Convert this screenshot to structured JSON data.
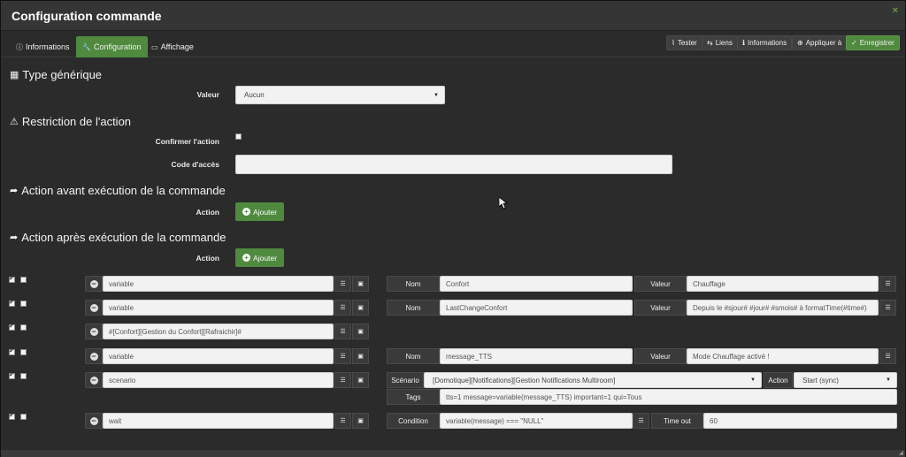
{
  "window": {
    "title": "Configuration commande",
    "close": "×"
  },
  "tabs": [
    {
      "label": "Informations",
      "icon": "ⓘ"
    },
    {
      "label": "Configuration",
      "icon": "🔧"
    },
    {
      "label": "Affichage",
      "icon": "▭"
    }
  ],
  "toolbar": {
    "tester": "Tester",
    "liens": "Liens",
    "informations": "Informations",
    "appliquer": "Appliquer à",
    "enregistrer": "Enregistrer",
    "icons": {
      "tester": "rss-icon",
      "liens": "link-icon",
      "informations": "info-icon",
      "appliquer": "plus-circle-icon",
      "enregistrer": "check-circle-icon"
    }
  },
  "generic_type": {
    "title": "Type générique",
    "valeur_label": "Valeur",
    "valeur_selected": "Aucun"
  },
  "restriction": {
    "title": "Restriction de l'action",
    "confirm_label": "Confirmer l'action",
    "confirm_checked": false,
    "code_label": "Code d'accès",
    "code_value": ""
  },
  "pre_exec": {
    "title": "Action avant exécution de la commande",
    "action_label": "Action",
    "add_label": "Ajouter"
  },
  "post_exec": {
    "title": "Action après exécution de la commande",
    "action_label": "Action",
    "add_label": "Ajouter",
    "rows": [
      {
        "cmd": "variable",
        "c1": "Nom",
        "v1": "Confort",
        "c2": "Valeur",
        "v2": "Chauffage"
      },
      {
        "cmd": "variable",
        "c1": "Nom",
        "v1": "LastChangeConfort",
        "c2": "Valeur",
        "v2": "Depuis le #sjour# #jour# #smois# à formatTime(#time#)"
      },
      {
        "cmd": "#[Confort][Gestion du Confort][Rafraichir]#"
      },
      {
        "cmd": "variable",
        "c1": "Nom",
        "v1": "message_TTS",
        "c2": "Valeur",
        "v2": "Mode Chauffage activé !"
      },
      {
        "cmd": "scenario",
        "c1": "Scénario",
        "v1": "[Domotique][Notifications][Gestion Notifications Multiroom]",
        "c2": "Action",
        "v2": "Start (sync)",
        "c3": "Tags",
        "v3": "tts=1 message=variable(message_TTS) important=1 qui=Tous"
      },
      {
        "cmd": "wait",
        "c1": "Condition",
        "v1": "variable(message) === \"NULL\"",
        "c2": "Time out",
        "v2": "60"
      }
    ]
  },
  "colors": {
    "background": "#2b2b2b",
    "accent_green": "#4f8a3f",
    "input_bg": "#f2f2f2"
  }
}
